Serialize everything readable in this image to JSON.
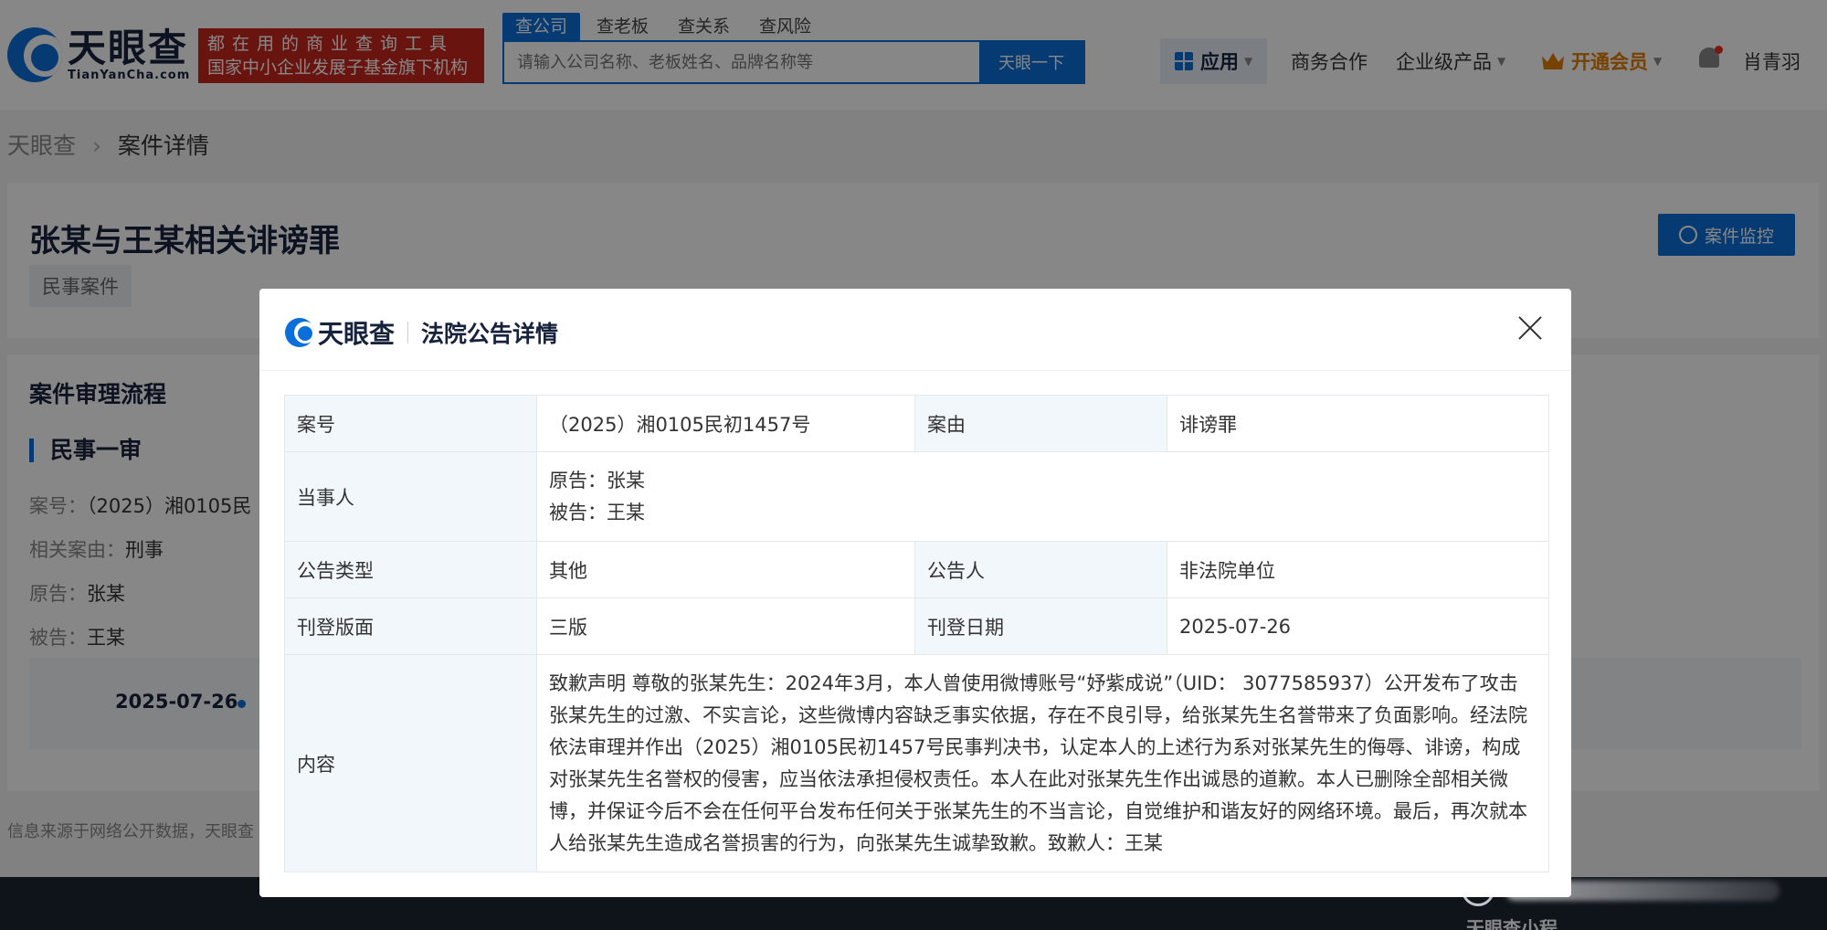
{
  "header": {
    "logo_cn": "天眼查",
    "logo_en": "TianYanCha.com",
    "slogan_line1": "都在用的商业查询工具",
    "slogan_line2": "国家中小企业发展子基金旗下机构",
    "search_tabs": [
      "查公司",
      "查老板",
      "查关系",
      "查风险"
    ],
    "search_placeholder": "请输入公司名称、老板姓名、品牌名称等",
    "search_button": "天眼一下",
    "nav_app": "应用",
    "nav_biz": "商务合作",
    "nav_enterprise": "企业级产品",
    "nav_vip": "开通会员",
    "user_name": "肖青羽"
  },
  "breadcrumb": {
    "home": "天眼查",
    "current": "案件详情"
  },
  "case": {
    "title": "张某与王某相关诽谤罪",
    "tag": "民事案件",
    "monitor_button": "案件监控"
  },
  "flow": {
    "title": "案件审理流程",
    "stage": "民事一审",
    "case_no_label": "案号：",
    "case_no_value": "（2025）湘0105民",
    "related_label": "相关案由：",
    "related_value": "刑事",
    "plaintiff_label": "原告：",
    "plaintiff_value": "张某",
    "defendant_label": "被告：",
    "defendant_value": "王某",
    "timeline_date": "2025-07-26"
  },
  "source_note": "信息来源于网络公开数据，天眼查",
  "footer_text": "天眼查小程",
  "modal": {
    "logo_text": "天眼查",
    "title": "法院公告详情",
    "rows": {
      "case_no_label": "案号",
      "case_no_value": "（2025）湘0105民初1457号",
      "cause_label": "案由",
      "cause_value": "诽谤罪",
      "party_label": "当事人",
      "plaintiff": "原告：张某",
      "defendant": "被告：王某",
      "type_label": "公告类型",
      "type_value": "其他",
      "announcer_label": "公告人",
      "announcer_value": "非法院单位",
      "page_label": "刊登版面",
      "page_value": "三版",
      "date_label": "刊登日期",
      "date_value": "2025-07-26",
      "content_label": "内容",
      "content_value": "致歉声明 尊敬的张某先生：2024年3月，本人曾使用微博账号“妤紫成说”（UID： 3077585937）公开发布了攻击张某先生的过激、不实言论，这些微博内容缺乏事实依据，存在不良引导，给张某先生名誉带来了负面影响。经法院依法审理并作出（2025）湘0105民初1457号民事判决书，认定本人的上述行为系对张某先生的侮辱、诽谤，构成对张某先生名誉权的侵害，应当依法承担侵权责任。本人在此对张某先生作出诚恳的道歉。本人已删除全部相关微博，并保证今后不会在任何平台发布任何关于张某先生的不当言论，自觉维护和谐友好的网络环境。最后，再次就本人给张某先生造成名誉损害的行为，向张某先生诚挚致歉。致歉人：王某"
    }
  },
  "colors": {
    "brand_blue": "#0a6fd8",
    "slogan_red": "#c8261e",
    "vip_orange": "#e07b00",
    "label_bg": "#f2f7fc"
  }
}
